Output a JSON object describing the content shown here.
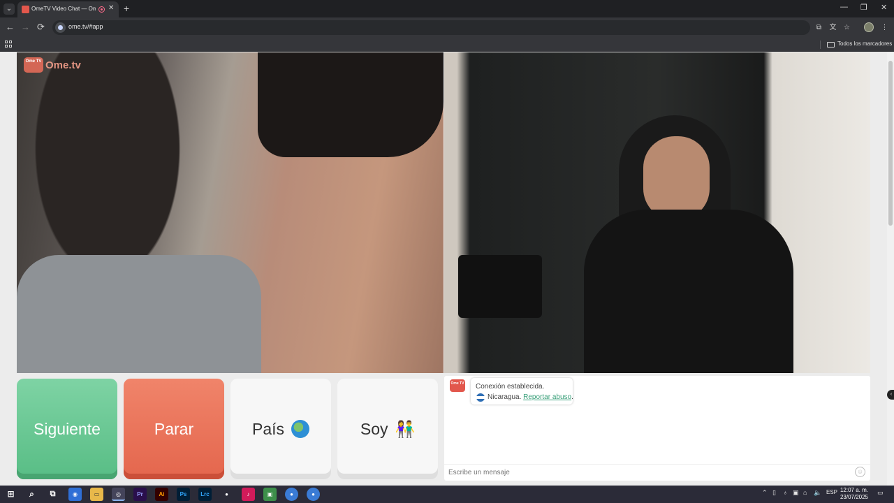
{
  "browser": {
    "tab_title": "OmeTV Video Chat — Ome",
    "tab_close": "✕",
    "new_tab": "+",
    "url": "ome.tv/#app",
    "bookmarks_label": "Todos los marcadores",
    "window": {
      "minimize": "—",
      "maximize": "❐",
      "close": "✕"
    }
  },
  "page": {
    "logo_badge": "Ome TV",
    "logo_text": "Ome.tv",
    "buttons": {
      "next": "Siguiente",
      "stop": "Parar",
      "country": "País",
      "gender": "Soy",
      "gender_glyph": "👫"
    },
    "chat": {
      "logo_badge": "Ome TV",
      "connection_message": "Conexión establecida.",
      "country": "Nicaragua.",
      "report_link": "Reportar abuso",
      "report_suffix": ".",
      "input_placeholder": "Escribe un mensaje"
    }
  },
  "taskbar": {
    "language": "ESP",
    "time": "12:07 a. m.",
    "date": "23/07/2025",
    "apps": {
      "premiere": "Pr",
      "illustrator": "Ai",
      "photoshop": "Ps",
      "lightroom": "Lrc"
    }
  },
  "colors": {
    "next_button": "#64c58f",
    "stop_button": "#ea7358",
    "link": "#3aa07a"
  }
}
